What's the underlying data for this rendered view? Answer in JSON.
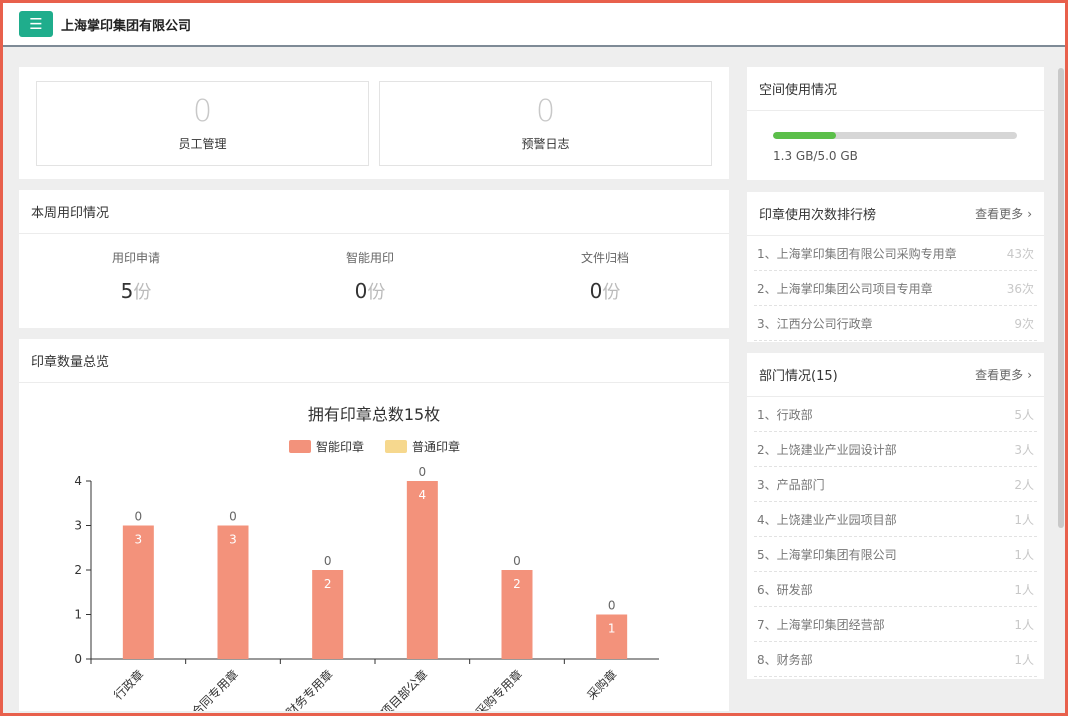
{
  "header": {
    "company": "上海掌印集团有限公司",
    "menu_icon": "menu-icon"
  },
  "stats": [
    {
      "value": "0",
      "label": "员工管理"
    },
    {
      "value": "0",
      "label": "预警日志"
    }
  ],
  "week": {
    "title": "本周用印情况",
    "items": [
      {
        "label": "用印申请",
        "value": "5",
        "unit": "份"
      },
      {
        "label": "智能用印",
        "value": "0",
        "unit": "份"
      },
      {
        "label": "文件归档",
        "value": "0",
        "unit": "份"
      }
    ]
  },
  "seal_overview": {
    "title": "印章数量总览"
  },
  "space": {
    "title": "空间使用情况",
    "usage_text": "1.3 GB/5.0 GB",
    "used": 1.3,
    "total": 5.0,
    "fill_color": "#5bbf4a"
  },
  "ranking": {
    "title": "印章使用次数排行榜",
    "more": "查看更多",
    "items": [
      {
        "name": "1、上海掌印集团有限公司采购专用章",
        "count": "43次"
      },
      {
        "name": "2、上海掌印集团公司项目专用章",
        "count": "36次"
      },
      {
        "name": "3、江西分公司行政章",
        "count": "9次"
      }
    ]
  },
  "departments": {
    "title": "部门情况(15)",
    "more": "查看更多",
    "items": [
      {
        "name": "1、行政部",
        "count": "5人"
      },
      {
        "name": "2、上饶建业产业园设计部",
        "count": "3人"
      },
      {
        "name": "3、产品部门",
        "count": "2人"
      },
      {
        "name": "4、上饶建业产业园项目部",
        "count": "1人"
      },
      {
        "name": "5、上海掌印集团有限公司",
        "count": "1人"
      },
      {
        "name": "6、研发部",
        "count": "1人"
      },
      {
        "name": "7、上海掌印集团经营部",
        "count": "1人"
      },
      {
        "name": "8、财务部",
        "count": "1人"
      }
    ]
  },
  "chart_data": {
    "type": "bar",
    "title": "拥有印章总数15枚",
    "categories": [
      "行政章",
      "合同专用章",
      "财务专用章",
      "项目部公章",
      "采购专用章",
      "采购章"
    ],
    "series": [
      {
        "name": "智能印章",
        "values": [
          3,
          3,
          2,
          4,
          2,
          1
        ],
        "color": "#f3927b"
      },
      {
        "name": "普通印章",
        "values": [
          0,
          0,
          0,
          0,
          0,
          0
        ],
        "color": "#f6d88e"
      }
    ],
    "ylim": [
      0,
      4
    ],
    "yticks": [
      0,
      1,
      2,
      3,
      4
    ],
    "legend": "top-center",
    "grid": false
  }
}
